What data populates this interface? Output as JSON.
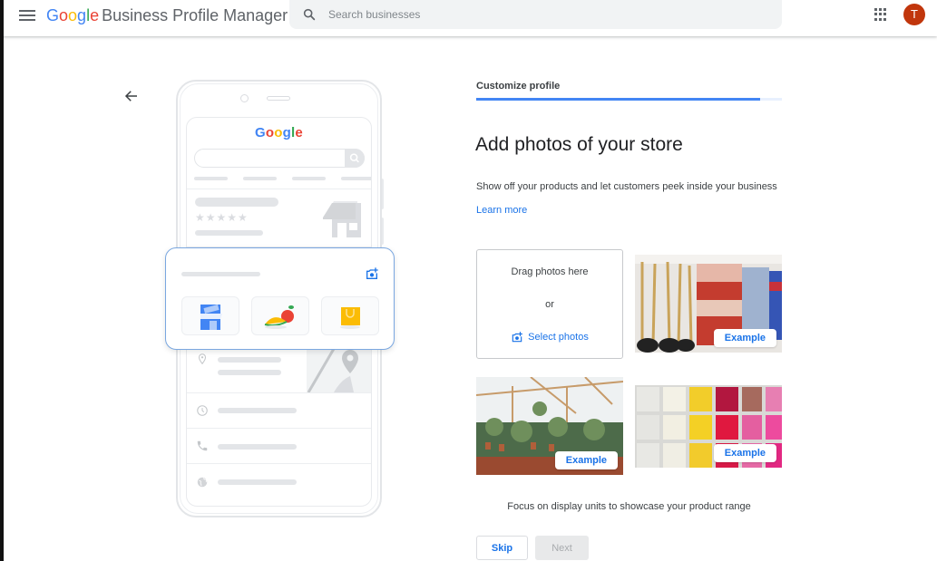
{
  "header": {
    "logo_letters": [
      {
        "char": "G",
        "color": "#4285f4"
      },
      {
        "char": "o",
        "color": "#ea4335"
      },
      {
        "char": "o",
        "color": "#fbbc05"
      },
      {
        "char": "g",
        "color": "#4285f4"
      },
      {
        "char": "l",
        "color": "#34a853"
      },
      {
        "char": "e",
        "color": "#ea4335"
      }
    ],
    "product_name": "Business Profile Manager",
    "search_placeholder": "Search businesses",
    "avatar_initial": "T",
    "avatar_color": "#c1360c"
  },
  "illustration": {
    "mini_logo": "Google",
    "stars": "★★★★★"
  },
  "main": {
    "step_label": "Customize profile",
    "progress_fraction": 0.93,
    "title": "Add photos of your store",
    "subtitle": "Show off your products and let customers peek inside your business",
    "learn_more": "Learn more",
    "dropzone": {
      "drag_text": "Drag photos here",
      "or_text": "or",
      "select_label": "Select photos"
    },
    "examples": [
      {
        "name": "hardware-store",
        "badge": "Example"
      },
      {
        "name": "garden-center",
        "badge": "Example"
      },
      {
        "name": "candle-shelves",
        "badge": "Example"
      }
    ],
    "caption": "Focus on display units to showcase your product range",
    "skip_label": "Skip",
    "next_label": "Next"
  },
  "colors": {
    "accent": "#1a73e8",
    "progress": "#4285f4"
  }
}
